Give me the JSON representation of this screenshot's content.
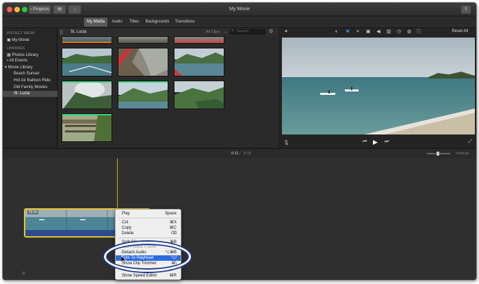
{
  "titlebar": {
    "back_label": "Projects",
    "title": "My Movie"
  },
  "tabs": [
    {
      "label": "My Media"
    },
    {
      "label": "Audio"
    },
    {
      "label": "Titles"
    },
    {
      "label": "Backgrounds"
    },
    {
      "label": "Transitions"
    }
  ],
  "sidebar": {
    "project_media_heading": "PROJECT MEDIA",
    "my_movie": "My Movie",
    "libraries_heading": "LIBRARIES",
    "photos_library": "Photos Library",
    "all_events": "All Events",
    "movie_library": "Movie Library",
    "events": [
      "Beach Sunset",
      "Hot Air Balloon Ride",
      "Old Family Movies",
      "St. Lucia"
    ]
  },
  "browser": {
    "event_title": "St. Lucia",
    "filter": "All Clips",
    "search_placeholder": "Search"
  },
  "viewer": {
    "reset_all": "Reset All"
  },
  "timeline": {
    "current_time": "0:11",
    "separator": "/",
    "total_time": "0:19",
    "settings": "Settings",
    "clip_duration": "16.0s"
  },
  "context_menu": {
    "play": "Play",
    "play_sc": "Space",
    "cut": "Cut",
    "cut_sc": "⌘X",
    "copy": "Copy",
    "copy_sc": "⌘C",
    "delete": "Delete",
    "delete_sc": "⌫",
    "split_clip": "Split Clip",
    "split_clip_sc": "⌘B",
    "add_freeze_frame": "Add Freeze Frame",
    "detach_audio": "Detach Audio",
    "detach_audio_sc": "⌥⌘B",
    "trim_to_playhead": "Trim To Playhead",
    "trim_to_playhead_sc": "⌥/",
    "show_clip_trimmer": "Show Clip Trimmer",
    "show_clip_trimmer_sc": "⌘\\",
    "show_speed_editor": "Show Speed Editor",
    "show_speed_editor_sc": "⌘R"
  },
  "colors": {
    "accent_blue": "#2d6be0",
    "clip_yellow": "#e6c62a",
    "window_bg": "#202020",
    "highlight_ring": "#ffffff"
  }
}
